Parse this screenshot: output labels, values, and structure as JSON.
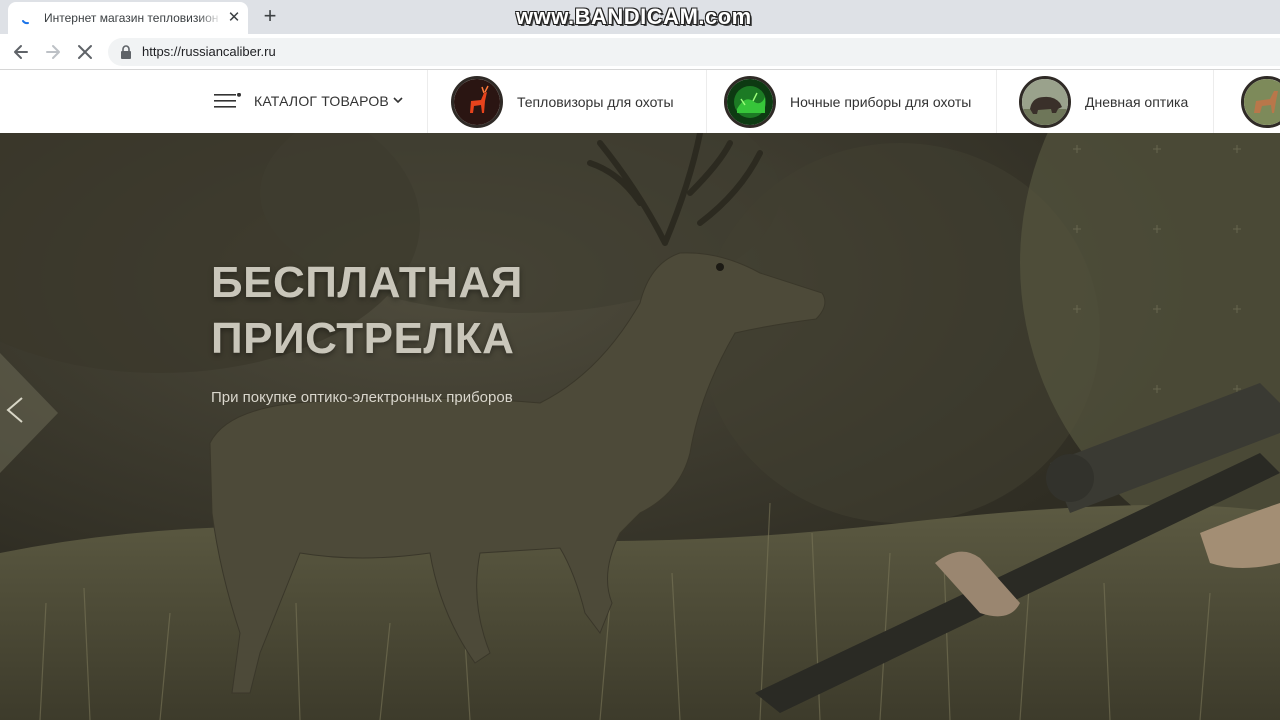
{
  "browser": {
    "tab_title": "Интернет магазин тепловизион",
    "tab_close": "✕",
    "new_tab": "+",
    "url": "https://russiancaliber.ru"
  },
  "watermark": "www.BANDICAM.com",
  "header": {
    "catalog_label": "КАТАЛОГ ТОВАРОВ",
    "categories": [
      {
        "label": "Тепловизоры для охоты",
        "icon": "thermal-deer-thumbnail"
      },
      {
        "label": "Ночные приборы для охоты",
        "icon": "night-vision-thumbnail"
      },
      {
        "label": "Дневная оптика",
        "icon": "boar-thumbnail"
      },
      {
        "label": "",
        "icon": "deer-thumbnail"
      }
    ]
  },
  "hero": {
    "title_line1": "БЕСПЛАТНАЯ",
    "title_line2": "ПРИСТРЕЛКА",
    "subtitle": "При покупке оптико-электронных приборов"
  },
  "colors": {
    "hero_bg": "#4a4738",
    "title_text": "#c9c6ba",
    "header_bg": "#ffffff"
  }
}
